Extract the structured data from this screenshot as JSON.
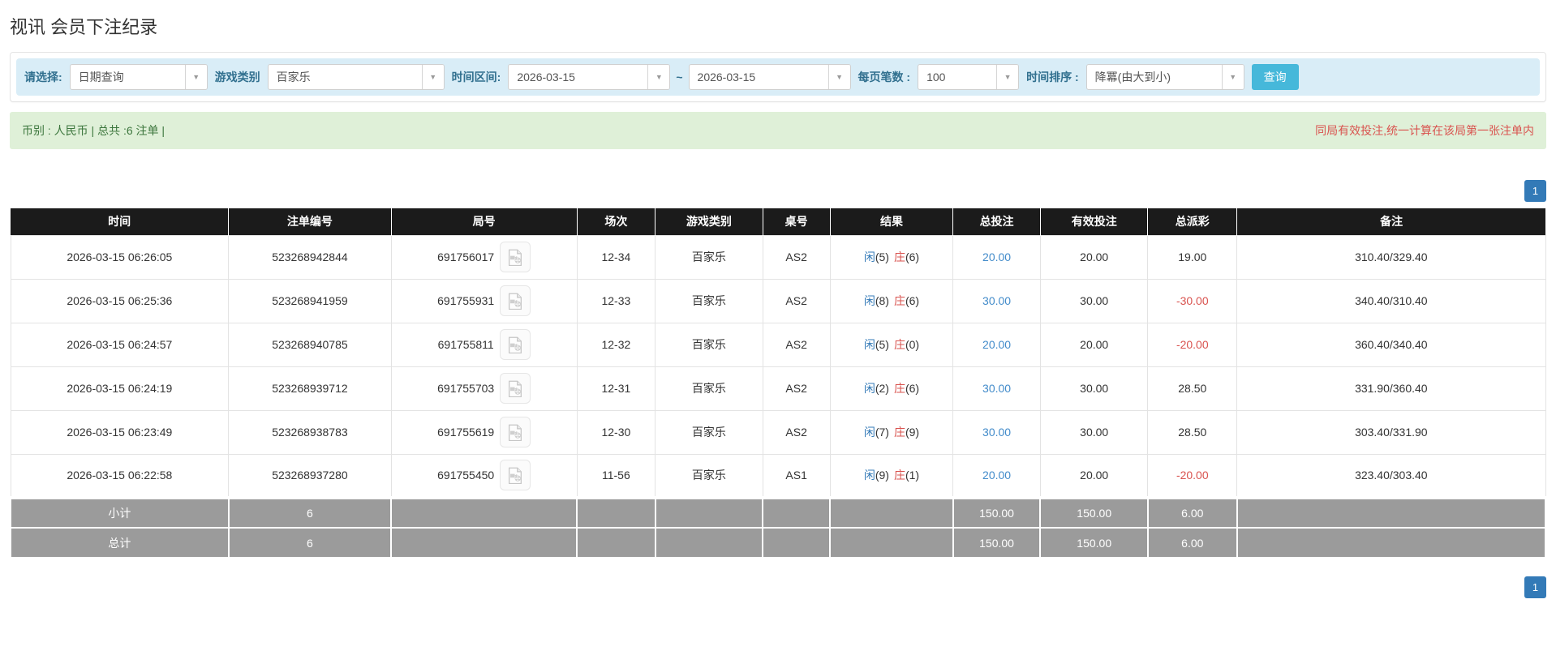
{
  "page": {
    "title": "视讯 会员下注纪录"
  },
  "icons": {
    "caret": "▼",
    "video_icon_name": "video-record-icon"
  },
  "colors": {
    "filter_bg": "#d9edf7",
    "filter_label": "#31708f",
    "summary_bg": "#dff0d8",
    "summary_text": "#3c763d",
    "warning_text": "#d9534f",
    "header_bg": "#1b1b1b",
    "footer_bg": "#9b9b9b",
    "accent_blue": "#337ab7",
    "link_blue": "#428bca",
    "search_btn": "#46b8da",
    "player_blue": "#337ab7",
    "banker_red": "#d9534f",
    "negative_red": "#d9534f"
  },
  "filters": {
    "select_label": "请选择:",
    "select_value": "日期查询",
    "game_type_label": "游戏类别",
    "game_type_value": "百家乐",
    "time_range_label": "时间区间:",
    "date_from": "2026-03-15",
    "tilde": "~",
    "date_to": "2026-03-15",
    "page_size_label": "每页笔数 :",
    "page_size_value": "100",
    "sort_label": "时间排序 :",
    "sort_value": "降冪(由大到小)",
    "search_button": "查询"
  },
  "summary": {
    "left": "币别 : 人民币 | 总共 :6 注单 |",
    "right": "同局有效投注,统一计算在该局第一张注单内"
  },
  "pagination": {
    "page": "1"
  },
  "table": {
    "headers": [
      "时间",
      "注单编号",
      "局号",
      "场次",
      "游戏类别",
      "桌号",
      "结果",
      "总投注",
      "有效投注",
      "总派彩",
      "备注"
    ],
    "rows": [
      {
        "time": "2026-03-15 06:26:05",
        "bet_id": "523268942844",
        "round_id": "691756017",
        "session": "12-34",
        "game": "百家乐",
        "table_no": "AS2",
        "res_p": "闲",
        "res_pn": "(5)",
        "res_b": "庄",
        "res_bn": "(6)",
        "total_bet": "20.00",
        "valid_bet": "20.00",
        "payout": "19.00",
        "payout_negative": false,
        "remark": "310.40/329.40"
      },
      {
        "time": "2026-03-15 06:25:36",
        "bet_id": "523268941959",
        "round_id": "691755931",
        "session": "12-33",
        "game": "百家乐",
        "table_no": "AS2",
        "res_p": "闲",
        "res_pn": "(8)",
        "res_b": "庄",
        "res_bn": "(6)",
        "total_bet": "30.00",
        "valid_bet": "30.00",
        "payout": "-30.00",
        "payout_negative": true,
        "remark": "340.40/310.40"
      },
      {
        "time": "2026-03-15 06:24:57",
        "bet_id": "523268940785",
        "round_id": "691755811",
        "session": "12-32",
        "game": "百家乐",
        "table_no": "AS2",
        "res_p": "闲",
        "res_pn": "(5)",
        "res_b": "庄",
        "res_bn": "(0)",
        "total_bet": "20.00",
        "valid_bet": "20.00",
        "payout": "-20.00",
        "payout_negative": true,
        "remark": "360.40/340.40"
      },
      {
        "time": "2026-03-15 06:24:19",
        "bet_id": "523268939712",
        "round_id": "691755703",
        "session": "12-31",
        "game": "百家乐",
        "table_no": "AS2",
        "res_p": "闲",
        "res_pn": "(2)",
        "res_b": "庄",
        "res_bn": "(6)",
        "total_bet": "30.00",
        "valid_bet": "30.00",
        "payout": "28.50",
        "payout_negative": false,
        "remark": "331.90/360.40"
      },
      {
        "time": "2026-03-15 06:23:49",
        "bet_id": "523268938783",
        "round_id": "691755619",
        "session": "12-30",
        "game": "百家乐",
        "table_no": "AS2",
        "res_p": "闲",
        "res_pn": "(7)",
        "res_b": "庄",
        "res_bn": "(9)",
        "total_bet": "30.00",
        "valid_bet": "30.00",
        "payout": "28.50",
        "payout_negative": false,
        "remark": "303.40/331.90"
      },
      {
        "time": "2026-03-15 06:22:58",
        "bet_id": "523268937280",
        "round_id": "691755450",
        "session": "11-56",
        "game": "百家乐",
        "table_no": "AS1",
        "res_p": "闲",
        "res_pn": "(9)",
        "res_b": "庄",
        "res_bn": "(1)",
        "total_bet": "20.00",
        "valid_bet": "20.00",
        "payout": "-20.00",
        "payout_negative": true,
        "remark": "323.40/303.40"
      }
    ],
    "subtotal": {
      "label": "小计",
      "count": "6",
      "total_bet": "150.00",
      "valid_bet": "150.00",
      "payout": "6.00"
    },
    "total": {
      "label": "总计",
      "count": "6",
      "total_bet": "150.00",
      "valid_bet": "150.00",
      "payout": "6.00"
    }
  }
}
